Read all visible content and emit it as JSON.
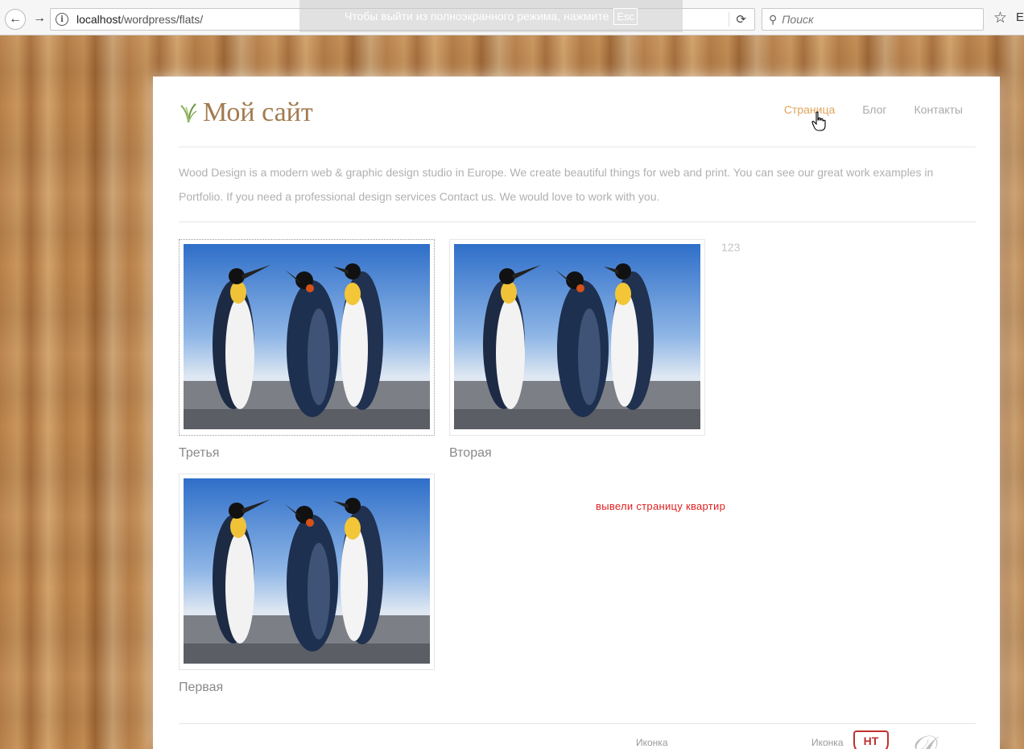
{
  "browser": {
    "url_host": "localhost",
    "url_path": "/wordpress/flats/",
    "fullscreen_notice": "Чтобы выйти из полноэкранного режима, нажмите",
    "esc_key": "Esc",
    "search_placeholder": "Поиск",
    "edge_letter": "E"
  },
  "site": {
    "title": "Мой сайт",
    "menu": [
      {
        "label": "Страница",
        "active": true
      },
      {
        "label": "Блог",
        "active": false
      },
      {
        "label": "Контакты",
        "active": false
      }
    ],
    "intro": "Wood Design is a modern web & graphic design studio in Europe. We create beautiful things for web and print. You can see our great work examples in Portfolio. If you need a professional design services Contact us. We would love to work with you."
  },
  "items": [
    {
      "title": "Третья"
    },
    {
      "title": "Вторая"
    },
    {
      "title": "Первая"
    }
  ],
  "side_count": "123",
  "note": "вывели страницу квартир",
  "footer": {
    "label_1": "Иконка",
    "label_2": "Иконка",
    "badge": "HT"
  },
  "colors": {
    "accent": "#e0a458",
    "logo": "#a27a4e",
    "note": "#e02020"
  }
}
